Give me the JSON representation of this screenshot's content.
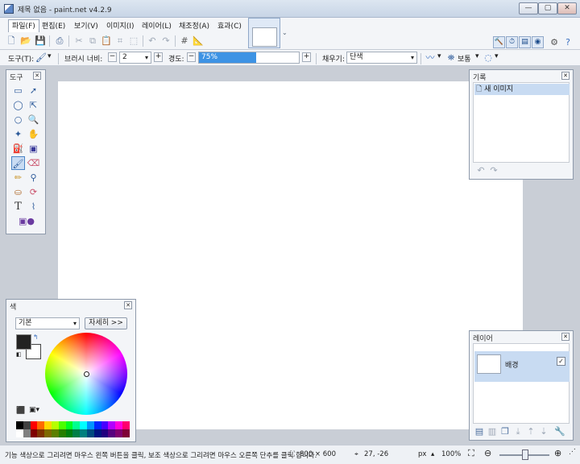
{
  "window": {
    "title": "제목 없음 - paint.net v4.2.9",
    "min_label": "—",
    "max_label": "▢",
    "close_label": "✕"
  },
  "menu": [
    {
      "label": "파일(F)",
      "active": true
    },
    {
      "label": "편집(E)"
    },
    {
      "label": "보기(V)"
    },
    {
      "label": "이미지(I)"
    },
    {
      "label": "레이어(L)"
    },
    {
      "label": "채조정(A)"
    },
    {
      "label": "효과(C)"
    }
  ],
  "toolbar_icons": [
    "new-icon",
    "open-icon",
    "save-icon",
    "print-icon",
    "cut-icon",
    "copy-icon",
    "paste-icon",
    "crop-icon",
    "deselect-icon",
    "undo-icon",
    "redo-icon",
    "grid-icon",
    "ruler-icon"
  ],
  "options": {
    "tool_label": "도구(T):",
    "brush_width_label": "브러시 너비:",
    "brush_width_value": "2",
    "hardness_label": "경도:",
    "hardness_value": "75%",
    "hardness_fraction": 0.75,
    "fill_label": "채우기:",
    "fill_value": "단색",
    "blend_label": "보통"
  },
  "tools_panel": {
    "title": "도구"
  },
  "history_panel": {
    "title": "기록",
    "items": [
      "새 이미지"
    ]
  },
  "layers_panel": {
    "title": "레이어",
    "layer_name": "배경",
    "layer_visible": "✓"
  },
  "colors_panel": {
    "title": "색",
    "palette_select": "기본",
    "more_button": "자세히 >>",
    "primary_color": "#222222",
    "secondary_color": "#ffffff"
  },
  "status": {
    "hint": "기능 색상으로 그리려면 마우스 왼쪽 버튼을 클릭, 보조 색상으로 그리려면 마우스 오른쪽 단추를 클릭 합니다.",
    "image_size": "800 × 600",
    "cursor_pos": "27, -26",
    "units": "px",
    "zoom": "100%"
  },
  "palette_colors": [
    "#000000",
    "#404040",
    "#ff0000",
    "#ff6a00",
    "#ffd800",
    "#b6ff00",
    "#4cff00",
    "#00ff21",
    "#00ff90",
    "#00ffff",
    "#0094ff",
    "#0026ff",
    "#4800ff",
    "#b200ff",
    "#ff00dc",
    "#ff006e",
    "#ffffff",
    "#808080",
    "#7f0000",
    "#7f3300",
    "#7f6a00",
    "#5b7f00",
    "#267f00",
    "#007f0e",
    "#007f46",
    "#007f7f",
    "#004a7f",
    "#00137f",
    "#21007f",
    "#57007f",
    "#7f006e",
    "#7f0037"
  ]
}
